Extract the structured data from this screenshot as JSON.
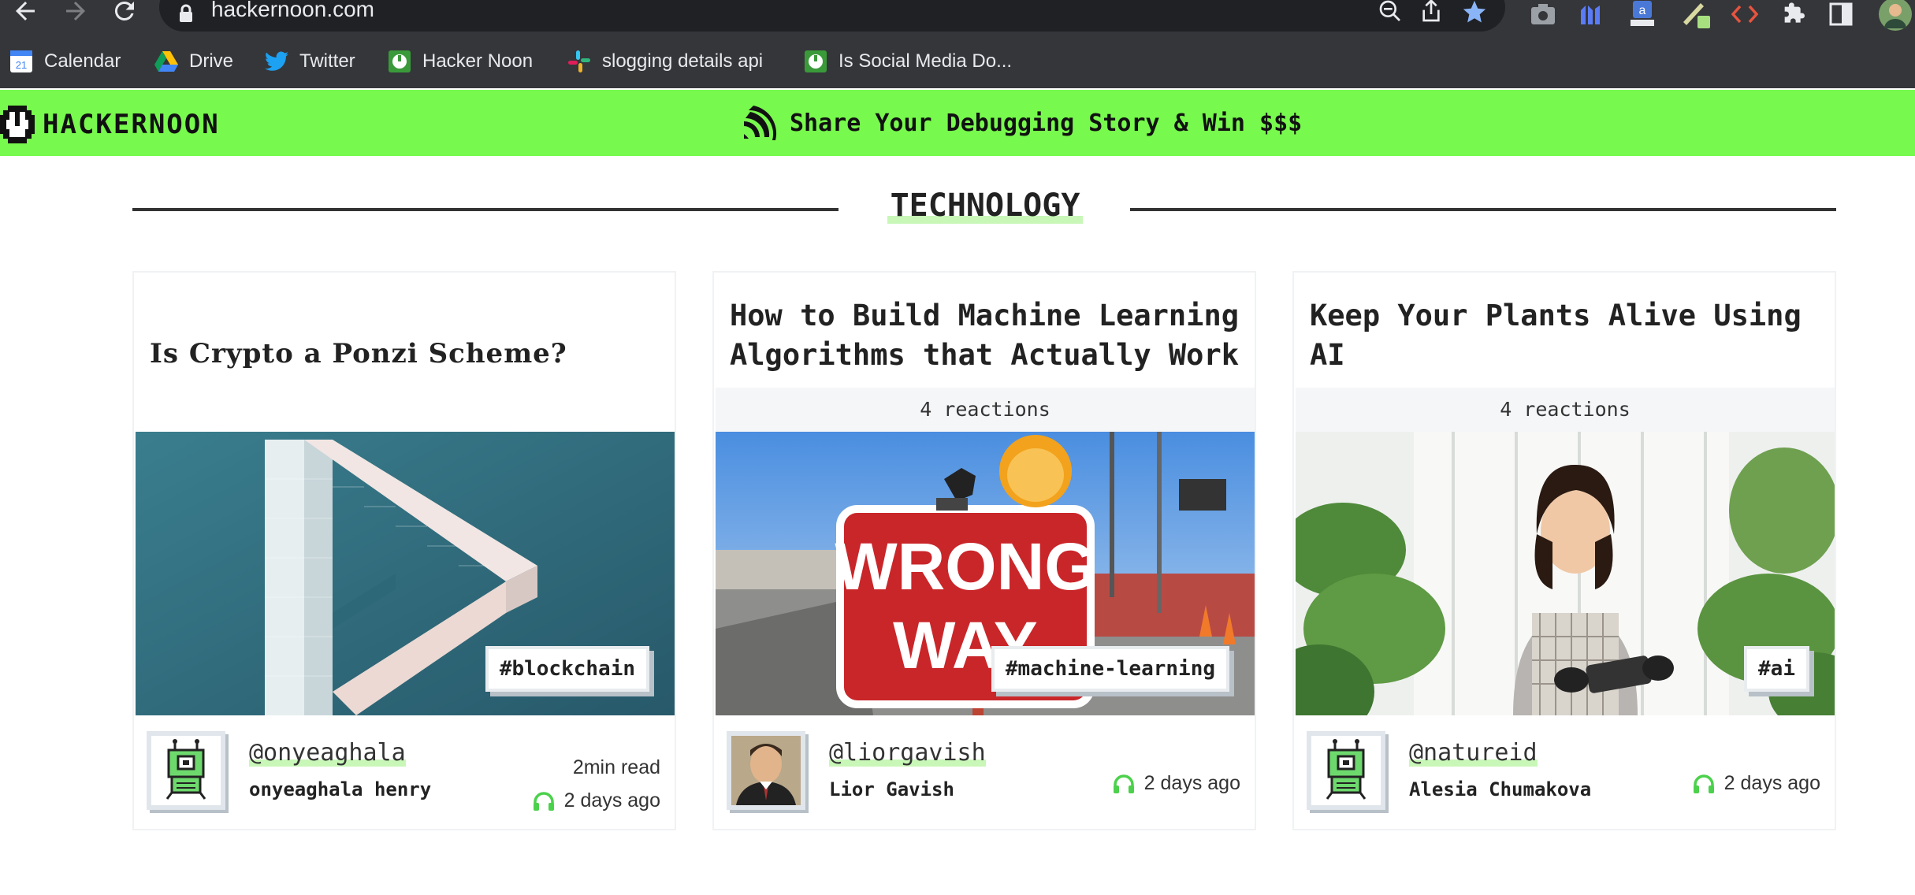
{
  "browser": {
    "url": "hackernoon.com",
    "bookmarks": [
      {
        "label": "Calendar",
        "icon": "calendar-icon"
      },
      {
        "label": "Drive",
        "icon": "drive-icon"
      },
      {
        "label": "Twitter",
        "icon": "twitter-icon"
      },
      {
        "label": "Hacker Noon",
        "icon": "hackernoon-icon"
      },
      {
        "label": "slogging details api",
        "icon": "slack-icon"
      },
      {
        "label": "Is Social Media Do...",
        "icon": "hackernoon-icon"
      }
    ],
    "calendar_day": "21"
  },
  "header": {
    "logo_text": "HACKERNOON",
    "promo_text": "Share Your Debugging Story & Win $$$",
    "bar_color": "#77f94d"
  },
  "section": {
    "title": "TECHNOLOGY"
  },
  "cards": [
    {
      "title": "Is Crypto a Ponzi Scheme?",
      "reactions": "",
      "tag": "#blockchain",
      "handle": "@onyeaghala",
      "author": "onyeaghala henry",
      "read_time": "2min read",
      "posted": "2 days ago"
    },
    {
      "title": "How to Build Machine Learning Algorithms that Actually Work",
      "reactions": "4 reactions",
      "tag": "#machine-learning",
      "handle": "@liorgavish",
      "author": "Lior Gavish",
      "read_time": "",
      "posted": "2 days ago",
      "sign_text": [
        "WRONG",
        "WAY"
      ]
    },
    {
      "title": "Keep Your Plants Alive Using AI",
      "reactions": "4 reactions",
      "tag": "#ai",
      "handle": "@natureid",
      "author": "Alesia Chumakova",
      "read_time": "",
      "posted": "2 days ago"
    }
  ],
  "colors": {
    "accent_green": "#77f94d",
    "highlight": "#c8f7b8",
    "chrome_dark": "#35363a"
  }
}
